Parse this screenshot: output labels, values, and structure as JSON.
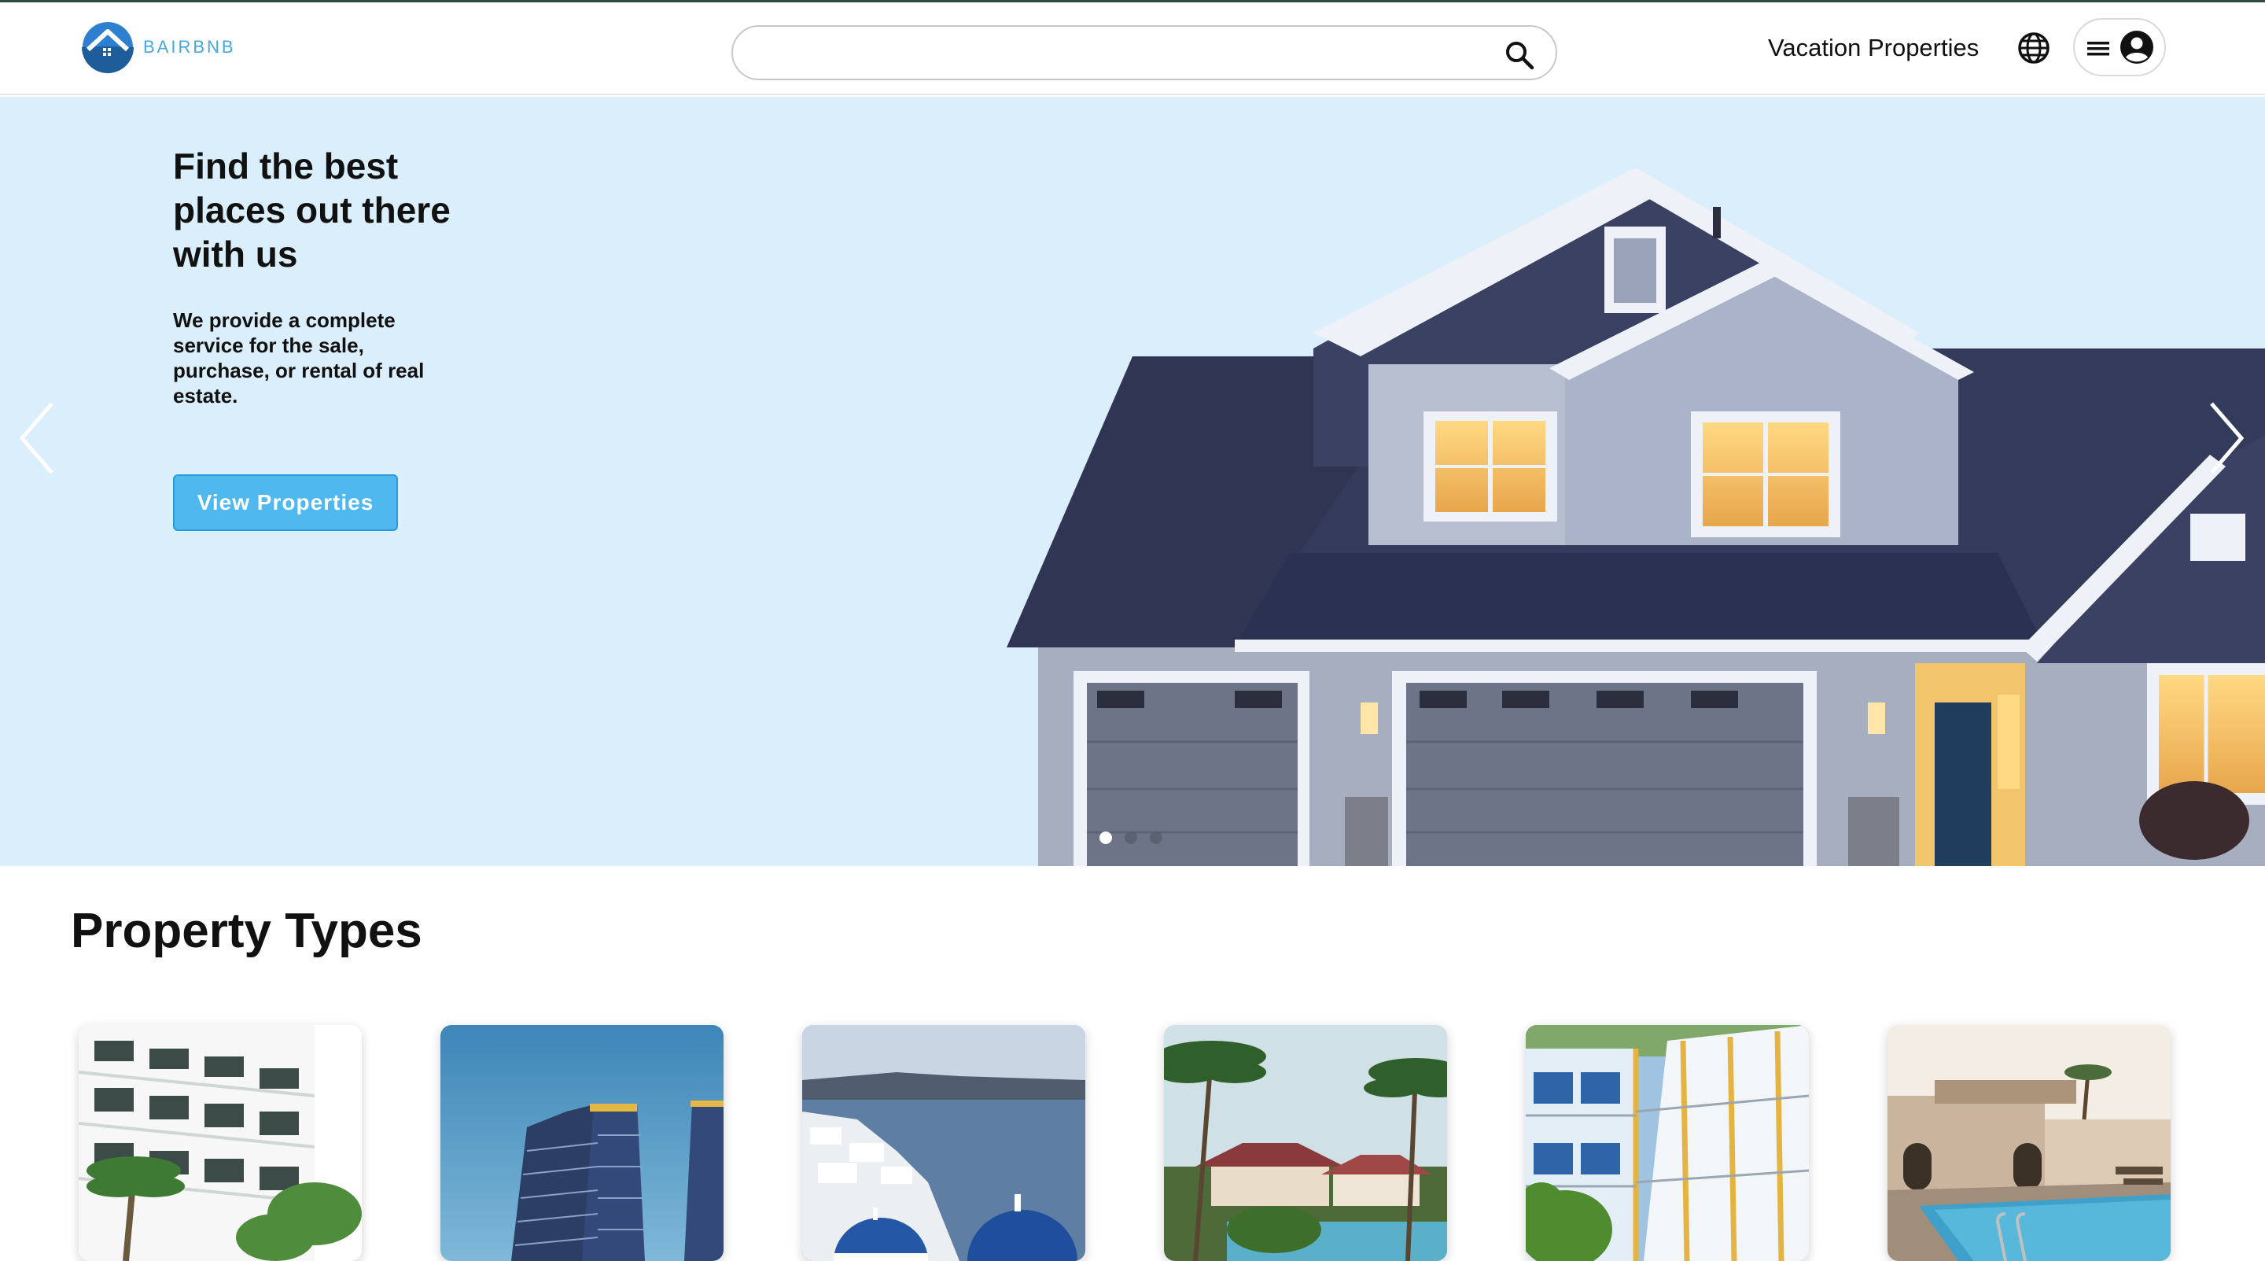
{
  "brand": {
    "name": "BAIRBNB",
    "color": "#45a7df"
  },
  "search": {
    "value": "",
    "placeholder": "",
    "icon": "search-icon"
  },
  "nav": {
    "vacation_label": "Vacation Properties",
    "globe_icon": "globe-icon",
    "menu_icon": "hamburger-icon",
    "account_icon": "account-circle-icon"
  },
  "hero": {
    "title": "Find the best places out there with us",
    "subtitle": "We provide a complete service for the sale, purchase, or rental of real estate.",
    "cta_label": "View Properties",
    "slide_count": 3,
    "active_slide": 1,
    "background": "#dbeefb",
    "accent": "#4fb8ef"
  },
  "property_types": {
    "title": "Property Types",
    "cards": [
      {
        "image": "hotel-building-with-palms"
      },
      {
        "image": "high-rise-apartment-tower"
      },
      {
        "image": "santorini-blue-domes"
      },
      {
        "image": "tropical-resort-with-palms"
      },
      {
        "image": "motel-courtyard-balconies"
      },
      {
        "image": "villa-with-pool"
      }
    ]
  }
}
